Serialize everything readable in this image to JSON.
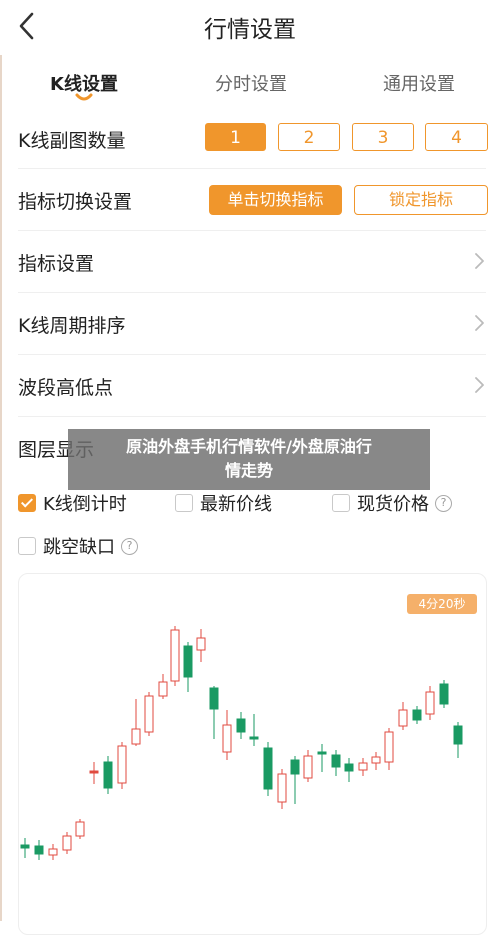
{
  "header": {
    "title": "行情设置",
    "back_icon": "chevron-left-icon"
  },
  "tabs": [
    {
      "label": "K线设置",
      "active": true
    },
    {
      "label": "分时设置",
      "active": false
    },
    {
      "label": "通用设置",
      "active": false
    }
  ],
  "subchart_count": {
    "label": "K线副图数量",
    "options": [
      "1",
      "2",
      "3",
      "4"
    ],
    "selected": "1"
  },
  "indicator_switch": {
    "label": "指标切换设置",
    "options": [
      "单击切换指标",
      "锁定指标"
    ],
    "selected": "单击切换指标"
  },
  "menu_rows": [
    {
      "label": "指标设置"
    },
    {
      "label": "K线周期排序"
    },
    {
      "label": "波段高低点"
    }
  ],
  "layer": {
    "label": "图层显示",
    "options": [
      {
        "label": "K线倒计时",
        "checked": true,
        "help": false
      },
      {
        "label": "最新价线",
        "checked": false,
        "help": false
      },
      {
        "label": "现货价格",
        "checked": false,
        "help": true
      },
      {
        "label": "跳空缺口",
        "checked": false,
        "help": true
      }
    ]
  },
  "chart_preview": {
    "badge": "4分20秒"
  },
  "overlay_caption": {
    "line1": "原油外盘手机行情软件/外盘原油行",
    "line2": "情走势"
  },
  "colors": {
    "accent": "#f0962c",
    "up": "#e04a3f",
    "down": "#1a9a63"
  }
}
